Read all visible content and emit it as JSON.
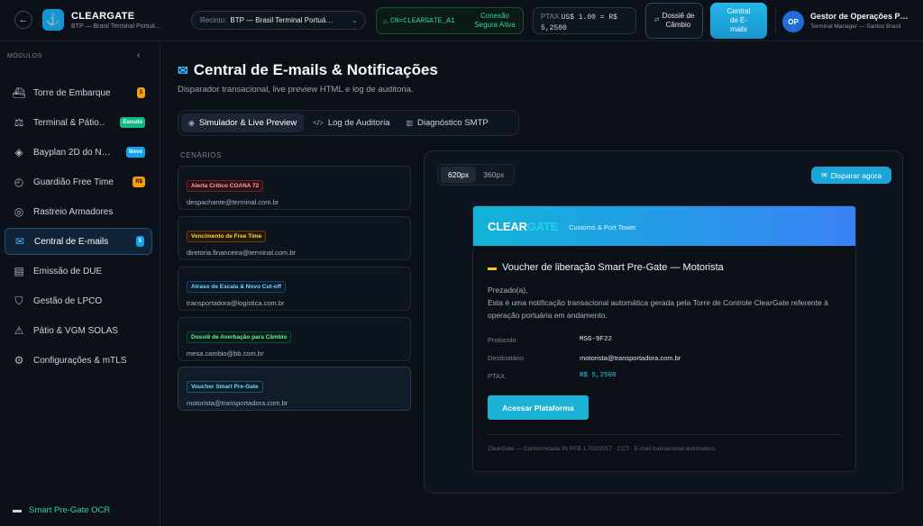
{
  "header": {
    "back_icon": "arrow-left-icon",
    "logo_icon": "anchor-icon",
    "brand_name": "CLEARGATE",
    "brand_sub": "BTP — Brasil Terminal Portuá…",
    "recinto_label": "Recinto:",
    "recinto_value": "BTP — Brasil Terminal Portuá…",
    "cn_value": "CN=CLEARGATE_A1",
    "connection_status": "Conexão Segura Ativa",
    "ptax_label": "PTAX",
    "ptax_value_line1": "US$ 1.00 = R$",
    "ptax_value_line2": "5,2500",
    "dossie_label": "Dossiê de Câmbio",
    "central_label": "Central de E-mails",
    "avatar_initials": "OP",
    "user_name": "Gestor de Operações Portuárias",
    "user_role": "Terminal Manager — Santos Brasil"
  },
  "sidebar": {
    "title": "MÓDULOS",
    "items": [
      {
        "label": "Torre de Embarque",
        "icon": "ship-icon",
        "badge": "3"
      },
      {
        "label": "Terminal & Pátio…",
        "icon": "scale-icon",
        "badge": "Escudo"
      },
      {
        "label": "Bayplan 2D do N…",
        "icon": "layers-icon",
        "badge": "Novo"
      },
      {
        "label": "Guardião Free Time",
        "icon": "timer-icon",
        "badge": "R$"
      },
      {
        "label": "Rastreio Armadores",
        "icon": "radar-icon",
        "badge": ""
      },
      {
        "label": "Central de E-mails",
        "icon": "mail-icon",
        "badge": "5"
      },
      {
        "label": "Emissão de DUE",
        "icon": "document-icon",
        "badge": ""
      },
      {
        "label": "Gestão de LPCO",
        "icon": "shield-icon",
        "badge": ""
      },
      {
        "label": "Pátio & VGM SOLAS",
        "icon": "weight-icon",
        "badge": ""
      },
      {
        "label": "Configurações & mTLS",
        "icon": "gear-icon",
        "badge": ""
      }
    ],
    "ocr_label": "Smart Pre-Gate OCR"
  },
  "main": {
    "title": "Central de E-mails & Notificações",
    "subtitle": "Disparador transacional, live preview HTML e log de auditoria.",
    "tabs": [
      {
        "label": "Simulador & Live Preview",
        "icon": "eye-icon"
      },
      {
        "label": "Log de Auditoria",
        "icon": "code-icon"
      },
      {
        "label": "Diagnóstico SMTP",
        "icon": "server-icon"
      }
    ],
    "scenarios_title": "CENÁRIOS",
    "scenarios": [
      {
        "tag": "Alerta Crítico COANA 72",
        "email": "despachante@terminal.com.br",
        "color": "#fca5a5"
      },
      {
        "tag": "Vencimento de Free Time",
        "email": "diretoria.financeira@terminal.com.br",
        "color": "#fcd34d"
      },
      {
        "tag": "Atraso de Escala & Novo Cut-off",
        "email": "transportadora@logistica.com.br",
        "color": "#7dd3fc"
      },
      {
        "tag": "Dossiê de Averbação para Câmbio",
        "email": "mesa.cambio@bb.com.br",
        "color": "#6ee7b7"
      },
      {
        "tag": "Voucher Smart Pre-Gate",
        "email": "motorista@transportadora.com.br",
        "color": "#7dd3fc"
      }
    ]
  },
  "preview": {
    "width_options": [
      "620px",
      "360px"
    ],
    "send_label": "Disparar agora",
    "email": {
      "brand_a": "CLEAR",
      "brand_b": "GATE",
      "brand_sub": "Customs & Port Tower",
      "subject": "Voucher de liberação Smart Pre-Gate — Motorista",
      "greeting": "Prezado(a),",
      "body": "Esta é uma notificação transacional automática gerada pela Torre de Controle ClearGate referente à operação portuária em andamento.",
      "fields": [
        {
          "key": "Protocolo",
          "value": "MSG-9F22"
        },
        {
          "key": "Destinatário",
          "value": "motorista@transportadora.com.br"
        },
        {
          "key": "PTAX",
          "value": "R$ 5,2500"
        }
      ],
      "cta": "Acessar Plataforma",
      "footer": "ClearGate — Conformidade IN RFB 1.702/2017 · CCT · E-mail transacional automático."
    }
  },
  "colors": {
    "accent": "#1aa6d9",
    "background": "#0b0f16",
    "success": "#34d399"
  }
}
